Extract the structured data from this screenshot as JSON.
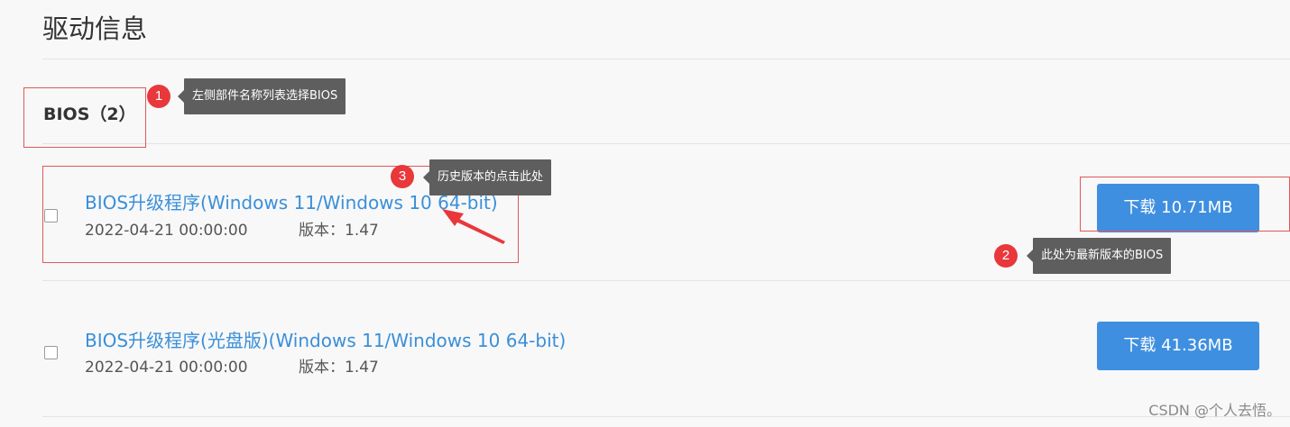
{
  "page": {
    "title": "驱动信息"
  },
  "section": {
    "title": "BIOS（2）"
  },
  "items": [
    {
      "title": "BIOS升级程序(Windows 11/Windows 10 64-bit)",
      "date": "2022-04-21 00:00:00",
      "version": "版本：1.47",
      "download_label": "下载 10.71MB"
    },
    {
      "title": "BIOS升级程序(光盘版)(Windows 11/Windows 10 64-bit)",
      "date": "2022-04-21 00:00:00",
      "version": "版本：1.47",
      "download_label": "下载 41.36MB"
    }
  ],
  "annotations": [
    {
      "number": "1",
      "text": "左侧部件名称列表选择BIOS"
    },
    {
      "number": "2",
      "text": "此处为最新版本的BIOS"
    },
    {
      "number": "3",
      "text": "历史版本的点击此处"
    }
  ],
  "watermark": "CSDN @个人去悟。",
  "colors": {
    "link": "#3a8fd9",
    "button": "#3f8fe0",
    "annotation_badge": "#e8383b",
    "annotation_tooltip": "#5e5e5e",
    "highlight_box": "#e05858"
  }
}
